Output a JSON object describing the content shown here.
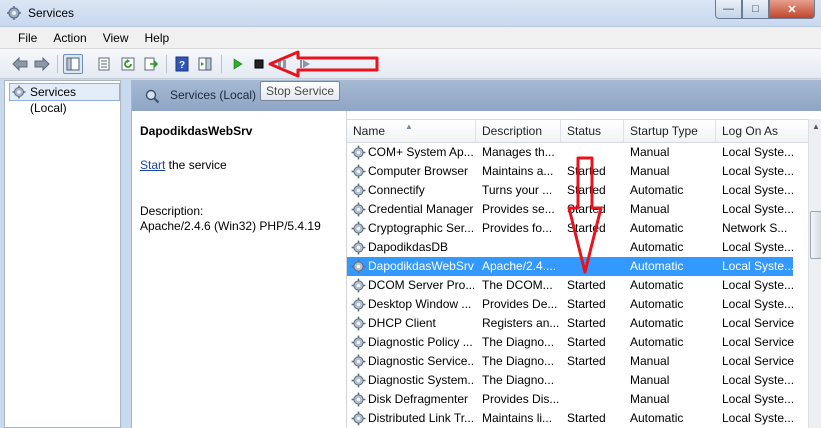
{
  "window": {
    "title": "Services",
    "controls": {
      "minimize": "—",
      "maximize": "□",
      "close": "✕"
    }
  },
  "menu": [
    "File",
    "Action",
    "View",
    "Help"
  ],
  "toolbar": {
    "tooltip": "Stop Service"
  },
  "tree": {
    "root_label": "Services (Local)"
  },
  "pane_header": {
    "title": "Services (Local)"
  },
  "details": {
    "service_name": "DapodikdasWebSrv",
    "action_link": "Start",
    "action_rest": " the service",
    "description_label": "Description:",
    "description": "Apache/2.4.6 (Win32) PHP/5.4.19"
  },
  "columns": [
    "Name",
    "Description",
    "Status",
    "Startup Type",
    "Log On As"
  ],
  "rows": [
    {
      "name": "COM+ System Ap...",
      "description": "Manages th...",
      "status": "",
      "startup": "Manual",
      "logon": "Local Syste..."
    },
    {
      "name": "Computer Browser",
      "description": "Maintains a...",
      "status": "Started",
      "startup": "Manual",
      "logon": "Local Syste..."
    },
    {
      "name": "Connectify",
      "description": "Turns your ...",
      "status": "Started",
      "startup": "Automatic",
      "logon": "Local Syste..."
    },
    {
      "name": "Credential Manager",
      "description": "Provides se...",
      "status": "Started",
      "startup": "Manual",
      "logon": "Local Syste..."
    },
    {
      "name": "Cryptographic Ser...",
      "description": "Provides fo...",
      "status": "Started",
      "startup": "Automatic",
      "logon": "Network S..."
    },
    {
      "name": "DapodikdasDB",
      "description": "",
      "status": "",
      "startup": "Automatic",
      "logon": "Local Syste..."
    },
    {
      "name": "DapodikdasWebSrv",
      "description": "Apache/2.4....",
      "status": "",
      "startup": "Automatic",
      "logon": "Local Syste...",
      "selected": true
    },
    {
      "name": "DCOM Server Pro...",
      "description": "The DCOM...",
      "status": "Started",
      "startup": "Automatic",
      "logon": "Local Syste..."
    },
    {
      "name": "Desktop Window ...",
      "description": "Provides De...",
      "status": "Started",
      "startup": "Automatic",
      "logon": "Local Syste..."
    },
    {
      "name": "DHCP Client",
      "description": "Registers an...",
      "status": "Started",
      "startup": "Automatic",
      "logon": "Local Service"
    },
    {
      "name": "Diagnostic Policy ...",
      "description": "The Diagno...",
      "status": "Started",
      "startup": "Automatic",
      "logon": "Local Service"
    },
    {
      "name": "Diagnostic Service...",
      "description": "The Diagno...",
      "status": "Started",
      "startup": "Manual",
      "logon": "Local Service"
    },
    {
      "name": "Diagnostic System...",
      "description": "The Diagno...",
      "status": "",
      "startup": "Manual",
      "logon": "Local Syste..."
    },
    {
      "name": "Disk Defragmenter",
      "description": "Provides Dis...",
      "status": "",
      "startup": "Manual",
      "logon": "Local Syste..."
    },
    {
      "name": "Distributed Link Tr...",
      "description": "Maintains li...",
      "status": "Started",
      "startup": "Automatic",
      "logon": "Local Syste..."
    }
  ],
  "colors": {
    "selection": "#3399ff",
    "annotation": "#e8141d",
    "link": "#1a47a8"
  }
}
